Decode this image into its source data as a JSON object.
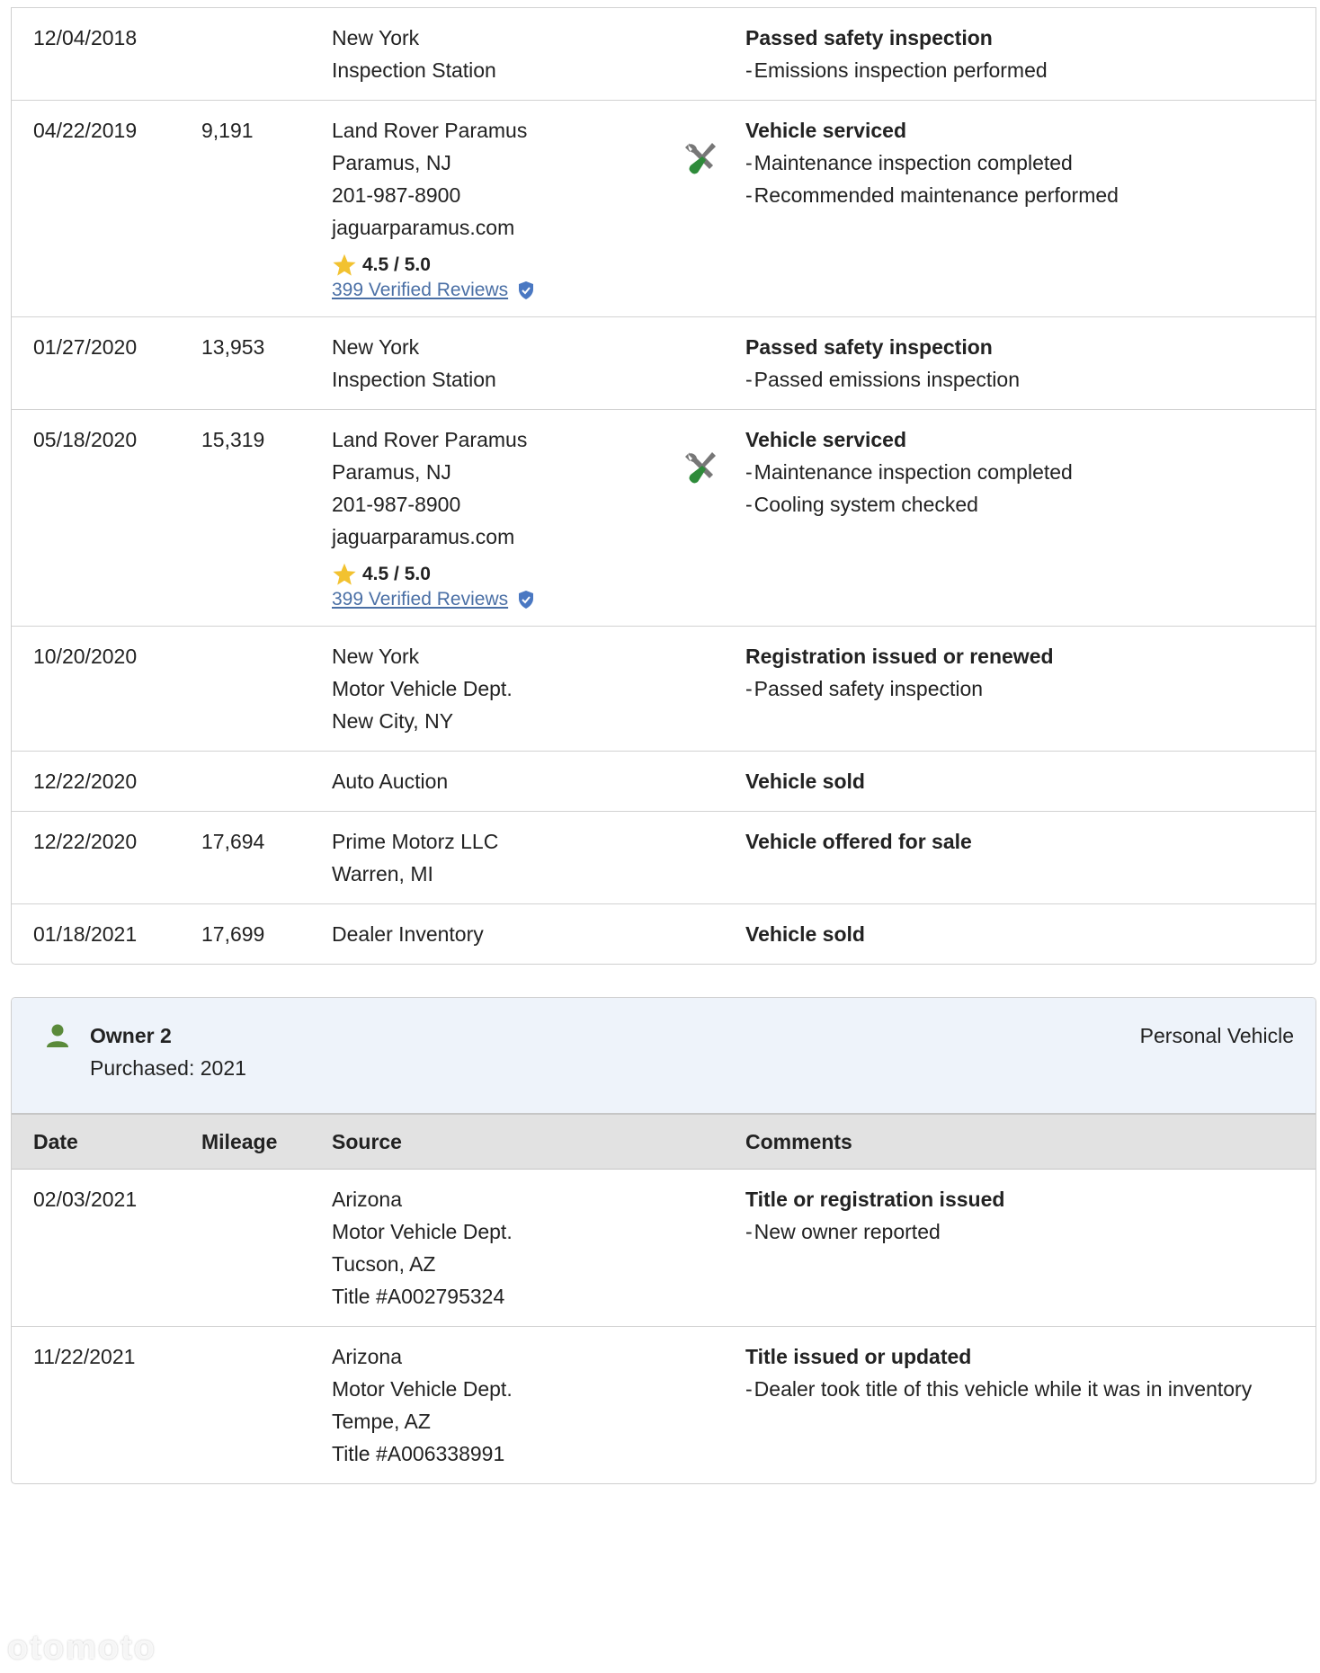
{
  "owner1_records": [
    {
      "date": "12/04/2018",
      "mileage": "",
      "source": [
        "New York",
        "Inspection Station"
      ],
      "has_service_icon": false,
      "title": "Passed safety inspection",
      "details": [
        "Emissions inspection performed"
      ]
    },
    {
      "date": "04/22/2019",
      "mileage": "9,191",
      "source": [
        "Land Rover Paramus",
        "Paramus, NJ",
        "201-987-8900",
        "jaguarparamus.com"
      ],
      "rating": "4.5 / 5.0",
      "reviews": "399 Verified Reviews",
      "has_service_icon": true,
      "title": "Vehicle serviced",
      "details": [
        "Maintenance inspection completed",
        "Recommended maintenance performed"
      ]
    },
    {
      "date": "01/27/2020",
      "mileage": "13,953",
      "source": [
        "New York",
        "Inspection Station"
      ],
      "has_service_icon": false,
      "title": "Passed safety inspection",
      "details": [
        "Passed emissions inspection"
      ]
    },
    {
      "date": "05/18/2020",
      "mileage": "15,319",
      "source": [
        "Land Rover Paramus",
        "Paramus, NJ",
        "201-987-8900",
        "jaguarparamus.com"
      ],
      "rating": "4.5 / 5.0",
      "reviews": "399 Verified Reviews",
      "has_service_icon": true,
      "title": "Vehicle serviced",
      "details": [
        "Maintenance inspection completed",
        "Cooling system checked"
      ]
    },
    {
      "date": "10/20/2020",
      "mileage": "",
      "source": [
        "New York",
        "Motor Vehicle Dept.",
        "New City, NY"
      ],
      "has_service_icon": false,
      "title": "Registration issued or renewed",
      "details": [
        "Passed safety inspection"
      ]
    },
    {
      "date": "12/22/2020",
      "mileage": "",
      "source": [
        "Auto Auction"
      ],
      "has_service_icon": false,
      "title": "Vehicle sold",
      "details": []
    },
    {
      "date": "12/22/2020",
      "mileage": "17,694",
      "source": [
        "Prime Motorz LLC",
        "Warren, MI"
      ],
      "has_service_icon": false,
      "title": "Vehicle offered for sale",
      "details": []
    },
    {
      "date": "01/18/2021",
      "mileage": "17,699",
      "source": [
        "Dealer Inventory"
      ],
      "has_service_icon": false,
      "title": "Vehicle sold",
      "details": []
    }
  ],
  "owner2": {
    "name": "Owner 2",
    "purchased": "Purchased: 2021",
    "usage": "Personal Vehicle",
    "icon": "person-icon"
  },
  "table_headers": {
    "date": "Date",
    "mileage": "Mileage",
    "source": "Source",
    "comments": "Comments"
  },
  "owner2_records": [
    {
      "date": "02/03/2021",
      "mileage": "",
      "source": [
        "Arizona",
        "Motor Vehicle Dept.",
        "Tucson, AZ",
        "Title #A002795324"
      ],
      "has_service_icon": false,
      "title": "Title or registration issued",
      "details": [
        "New owner reported"
      ]
    },
    {
      "date": "11/22/2021",
      "mileage": "",
      "source": [
        "Arizona",
        "Motor Vehicle Dept.",
        "Tempe, AZ",
        "Title #A006338991"
      ],
      "has_service_icon": false,
      "title": "Title issued or updated",
      "details": [
        "Dealer took title of this vehicle while it was in inventory"
      ]
    }
  ],
  "colors": {
    "star": "#f2c230",
    "link": "#4a6fa5",
    "shield": "#4a78c2",
    "tool_handle": "#2e8b3a",
    "tool_metal": "#777777",
    "owner_icon": "#5a8a3a",
    "owner_header_bg": "#eef3fa",
    "table_header_bg": "#e2e2e2"
  },
  "watermark": "otomoto"
}
